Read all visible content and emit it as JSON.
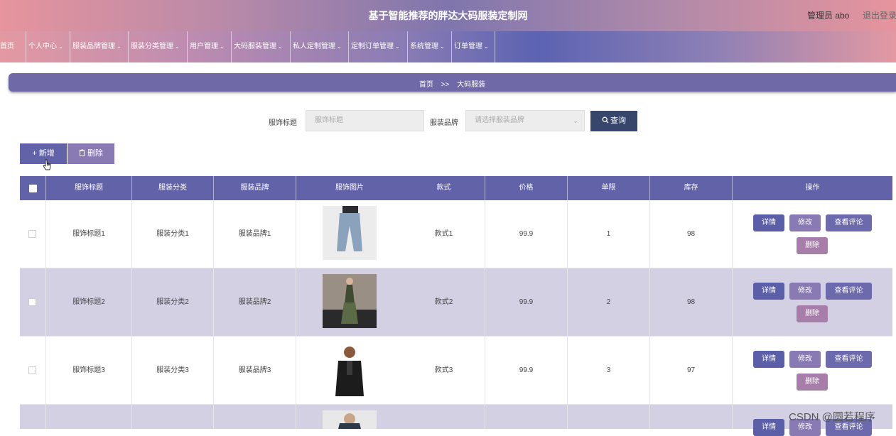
{
  "header": {
    "title": "基于智能推荐的胖达大码服装定制网",
    "admin": "管理员 abo",
    "logout": "退出登录"
  },
  "nav": [
    {
      "label": "首页",
      "chevron": false
    },
    {
      "label": "个人中心",
      "chevron": true
    },
    {
      "label": "服装品牌管理",
      "chevron": true
    },
    {
      "label": "服装分类管理",
      "chevron": true
    },
    {
      "label": "用户管理",
      "chevron": true
    },
    {
      "label": "大码服装管理",
      "chevron": true
    },
    {
      "label": "私人定制管理",
      "chevron": true
    },
    {
      "label": "定制订单管理",
      "chevron": true
    },
    {
      "label": "系统管理",
      "chevron": true
    },
    {
      "label": "订单管理",
      "chevron": true
    }
  ],
  "breadcrumb": {
    "home": "首页",
    "sep": ">>",
    "current": "大码服装"
  },
  "search": {
    "title_label": "服饰标题",
    "title_placeholder": "服饰标题",
    "brand_label": "服装品牌",
    "brand_placeholder": "请选择服装品牌",
    "query_button": "查询"
  },
  "actions": {
    "add": "+ 新增",
    "delete": "删除"
  },
  "table": {
    "columns": [
      "服饰标题",
      "服装分类",
      "服装品牌",
      "服饰图片",
      "款式",
      "价格",
      "单限",
      "库存",
      "操作"
    ],
    "rows": [
      {
        "title": "服饰标题1",
        "category": "服装分类1",
        "brand": "服装品牌1",
        "style": "款式1",
        "price": "99.9",
        "limit": "1",
        "stock": "98",
        "image": "jeans-photo"
      },
      {
        "title": "服饰标题2",
        "category": "服装分类2",
        "brand": "服装品牌2",
        "style": "款式2",
        "price": "99.9",
        "limit": "2",
        "stock": "98",
        "image": "dress-photo"
      },
      {
        "title": "服饰标题3",
        "category": "服装分类3",
        "brand": "服装品牌3",
        "style": "款式3",
        "price": "99.9",
        "limit": "3",
        "stock": "97",
        "image": "jacket-photo"
      },
      {
        "title": "",
        "category": "",
        "brand": "",
        "style": "",
        "price": "",
        "limit": "",
        "stock": "",
        "image": "coat-photo"
      }
    ],
    "ops": {
      "detail": "详情",
      "edit": "修改",
      "review": "查看评论",
      "remove": "删除"
    }
  },
  "watermark": "CSDN @圆若程序",
  "colors": {
    "header_bg": "#7f76ad",
    "table_header": "#6262a8",
    "alt_row": "#d3d0e4",
    "query_button": "#37466a"
  }
}
